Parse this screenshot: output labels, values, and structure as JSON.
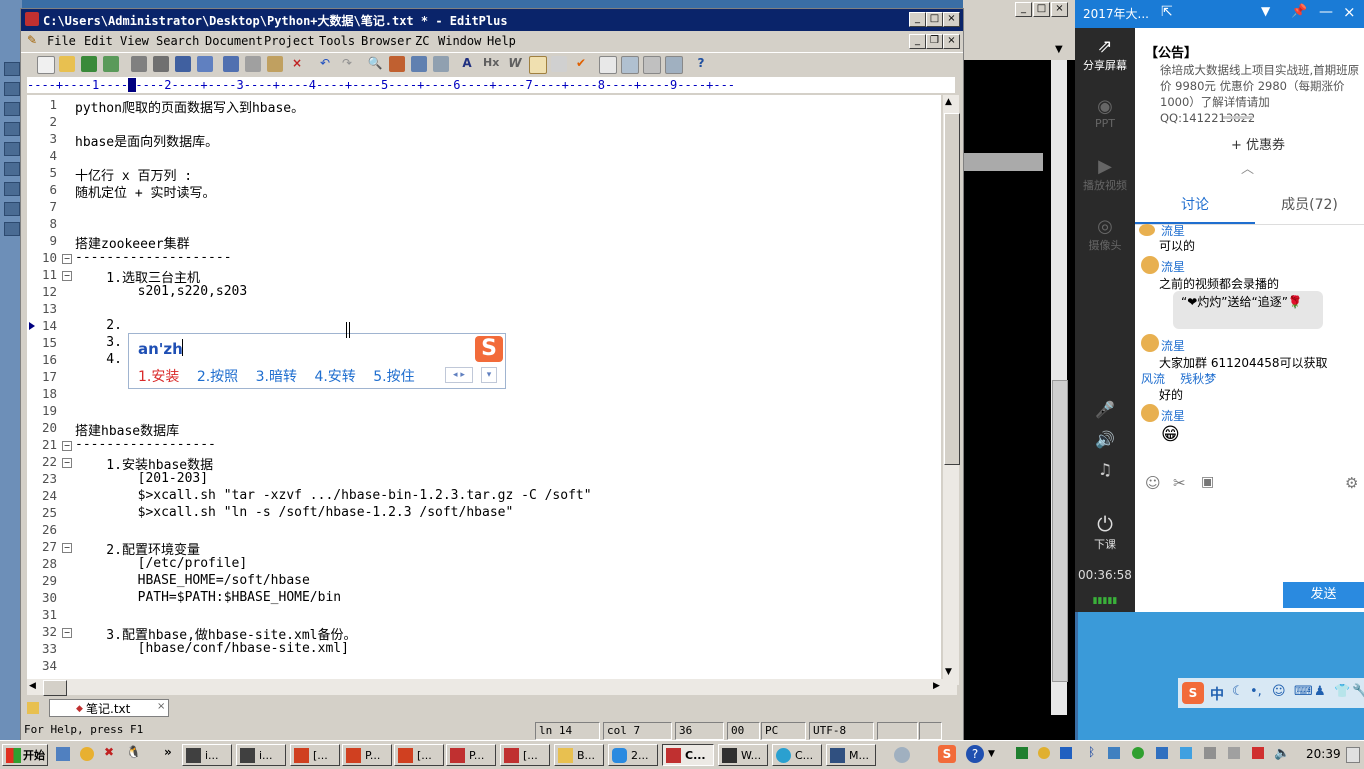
{
  "editplus": {
    "title": "C:\\Users\\Administrator\\Desktop\\Python+大数据\\笔记.txt * - EditPlus",
    "menu": [
      "File",
      "Edit",
      "View",
      "Search",
      "Document",
      "Project",
      "Tools",
      "Browser",
      "ZC",
      "Window",
      "Help"
    ],
    "ruler": "----+----1----+----2----+----3----+----4----+----5----+----6----+----7----+----8----+----9----+---",
    "lines": [
      {
        "n": "1",
        "text": "python爬取的页面数据写入到hbase。"
      },
      {
        "n": "2",
        "text": ""
      },
      {
        "n": "3",
        "text": "hbase是面向列数据库。"
      },
      {
        "n": "4",
        "text": ""
      },
      {
        "n": "5",
        "text": "十亿行 x 百万列 :"
      },
      {
        "n": "6",
        "text": "随机定位 + 实时读写。"
      },
      {
        "n": "7",
        "text": ""
      },
      {
        "n": "8",
        "text": ""
      },
      {
        "n": "9",
        "text": "搭建zookeeer集群"
      },
      {
        "n": "10",
        "text": "--------------------",
        "fold": true
      },
      {
        "n": "11",
        "text": "    1.选取三台主机",
        "fold": true
      },
      {
        "n": "12",
        "text": "        s201,s220,s203"
      },
      {
        "n": "13",
        "text": ""
      },
      {
        "n": "14",
        "text": "    2."
      },
      {
        "n": "15",
        "text": "    3."
      },
      {
        "n": "16",
        "text": "    4."
      },
      {
        "n": "17",
        "text": ""
      },
      {
        "n": "18",
        "text": ""
      },
      {
        "n": "19",
        "text": ""
      },
      {
        "n": "20",
        "text": "搭建hbase数据库"
      },
      {
        "n": "21",
        "text": "------------------",
        "fold": true
      },
      {
        "n": "22",
        "text": "    1.安装hbase数据",
        "fold": true
      },
      {
        "n": "23",
        "text": "        [201-203]"
      },
      {
        "n": "24",
        "text": "        $>xcall.sh \"tar -xzvf .../hbase-bin-1.2.3.tar.gz -C /soft\""
      },
      {
        "n": "25",
        "text": "        $>xcall.sh \"ln -s /soft/hbase-1.2.3 /soft/hbase\""
      },
      {
        "n": "26",
        "text": ""
      },
      {
        "n": "27",
        "text": "    2.配置环境变量",
        "fold": true
      },
      {
        "n": "28",
        "text": "        [/etc/profile]"
      },
      {
        "n": "29",
        "text": "        HBASE_HOME=/soft/hbase"
      },
      {
        "n": "30",
        "text": "        PATH=$PATH:$HBASE_HOME/bin"
      },
      {
        "n": "31",
        "text": ""
      },
      {
        "n": "32",
        "text": "    3.配置hbase,做hbase-site.xml备份。",
        "fold": true
      },
      {
        "n": "33",
        "text": "        [hbase/conf/hbase-site.xml]"
      },
      {
        "n": "34",
        "text": ""
      }
    ],
    "tab_label": "笔记.txt",
    "status": {
      "help": "For Help, press F1",
      "ln": "ln 14",
      "col": "col 7",
      "c36": "36",
      "c00": "00",
      "pc": "PC",
      "enc": "UTF-8"
    }
  },
  "ime": {
    "input": "an'zh",
    "candidates": [
      "1.安装",
      "2.按照",
      "3.暗转",
      "4.安转",
      "5.按住"
    ]
  },
  "chat": {
    "title": "2017年大...",
    "sidebar": [
      {
        "label": "分享屏幕",
        "icon": "share-screen-icon"
      },
      {
        "label": "PPT",
        "icon": "ppt-icon"
      },
      {
        "label": "播放视频",
        "icon": "play-video-icon"
      },
      {
        "label": "摄像头",
        "icon": "camera-icon"
      }
    ],
    "announcement_title": "【公告】",
    "announcement": "徐培成大数据线上项目实战班,首期班原价 9980元  优惠价 2980（每期涨价1000）了解详情请加QQ:1412213822",
    "coupon": "优惠券",
    "tabs": [
      "讨论",
      "成员(72)"
    ],
    "messages": [
      {
        "user": "流星",
        "text": "可以的"
      },
      {
        "user": "流星",
        "text": "之前的视频都会录播的"
      },
      {
        "user": "",
        "text": "“❤灼灼”送给“追逐”🌹"
      },
      {
        "user": "流星",
        "text": "大家加群 611204458可以获取"
      },
      {
        "user": "",
        "text": "风流    残秋梦"
      },
      {
        "user": "",
        "text": "好的"
      },
      {
        "user": "流星",
        "text": "😁"
      }
    ],
    "end_class": "下课",
    "timer": "00:36:58",
    "send": "发送"
  },
  "taskbar": {
    "start": "开始",
    "items": [
      "i...",
      "i...",
      "[...",
      "P...",
      "[...",
      "P...",
      "[...",
      "B...",
      "2...",
      "C...",
      "W...",
      "C...",
      "M..."
    ],
    "clock": "20:39",
    "ime_tray": "中"
  }
}
